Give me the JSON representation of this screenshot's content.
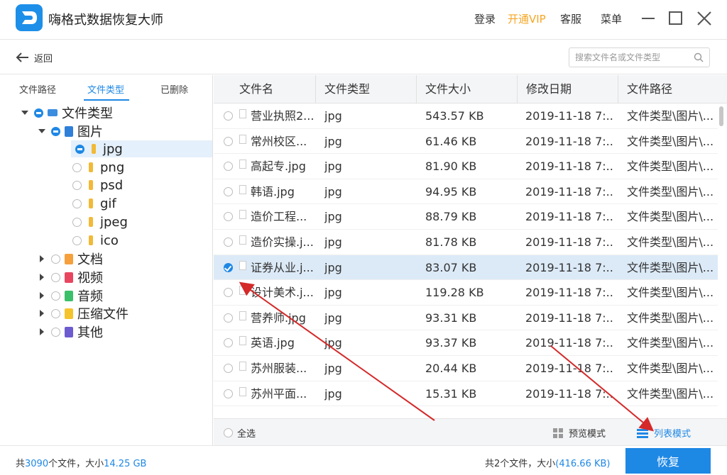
{
  "app": {
    "title": "嗨格式数据恢复大师"
  },
  "top_menu": {
    "login": "登录",
    "vip": "开通VIP",
    "service": "客服",
    "menu": "菜单"
  },
  "toolbar": {
    "back_label": "返回",
    "search_placeholder": "搜索文件名或文件类型"
  },
  "left_tabs": [
    "文件路径",
    "文件类型",
    "已删除"
  ],
  "tree": {
    "root": "文件类型",
    "images": "图片",
    "image_types": [
      "jpg",
      "png",
      "psd",
      "gif",
      "jpeg",
      "ico"
    ],
    "others": [
      "文档",
      "视频",
      "音频",
      "压缩文件",
      "其他"
    ]
  },
  "table": {
    "headers": [
      "文件名",
      "文件类型",
      "文件大小",
      "修改日期",
      "文件路径"
    ],
    "rows": [
      {
        "name": "营业执照2...",
        "type": "jpg",
        "size": "543.57 KB",
        "date": "2019-11-18 7:...",
        "path": "文件类型\\图片\\...",
        "checked": false
      },
      {
        "name": "常州校区...",
        "type": "jpg",
        "size": "61.46 KB",
        "date": "2019-11-18 7:...",
        "path": "文件类型\\图片\\...",
        "checked": false
      },
      {
        "name": "高起专.jpg",
        "type": "jpg",
        "size": "81.90 KB",
        "date": "2019-11-18 7:...",
        "path": "文件类型\\图片\\...",
        "checked": false
      },
      {
        "name": "韩语.jpg",
        "type": "jpg",
        "size": "94.95 KB",
        "date": "2019-11-18 7:...",
        "path": "文件类型\\图片\\...",
        "checked": false
      },
      {
        "name": "造价工程...",
        "type": "jpg",
        "size": "88.79 KB",
        "date": "2019-11-18 7:...",
        "path": "文件类型\\图片\\...",
        "checked": false
      },
      {
        "name": "造价实操.j...",
        "type": "jpg",
        "size": "81.78 KB",
        "date": "2019-11-18 7:...",
        "path": "文件类型\\图片\\...",
        "checked": false
      },
      {
        "name": "证券从业.j...",
        "type": "jpg",
        "size": "83.07 KB",
        "date": "2019-11-18 7:...",
        "path": "文件类型\\图片\\...",
        "checked": true
      },
      {
        "name": "设计美术.j...",
        "type": "jpg",
        "size": "119.28 KB",
        "date": "2019-11-18 7:...",
        "path": "文件类型\\图片\\...",
        "checked": false
      },
      {
        "name": "营养师.jpg",
        "type": "jpg",
        "size": "93.31 KB",
        "date": "2019-11-18 7:...",
        "path": "文件类型\\图片\\...",
        "checked": false
      },
      {
        "name": "英语.jpg",
        "type": "jpg",
        "size": "93.37 KB",
        "date": "2019-11-18 7:...",
        "path": "文件类型\\图片\\...",
        "checked": false
      },
      {
        "name": "苏州服装...",
        "type": "jpg",
        "size": "20.44 KB",
        "date": "2019-11-18 7:...",
        "path": "文件类型\\图片\\...",
        "checked": false
      },
      {
        "name": "苏州平面...",
        "type": "jpg",
        "size": "15.31 KB",
        "date": "2019-11-18 7:...",
        "path": "文件类型\\图片\\...",
        "checked": false
      }
    ]
  },
  "footer": {
    "select_all": "全选",
    "preview_mode": "预览模式",
    "list_mode": "列表模式"
  },
  "status": {
    "total_prefix": "共",
    "total_count": "3090",
    "total_mid": "个文件，大小",
    "total_size": "14.25 GB",
    "selected_prefix": "共2个文件，大小",
    "selected_size": "(416.66 KB)",
    "recover_label": "恢复"
  },
  "colors": {
    "accent": "#1e88e5",
    "vip": "#f5a623",
    "selected_row": "#dceaf7",
    "annotation_arrow": "#d42a2a"
  }
}
